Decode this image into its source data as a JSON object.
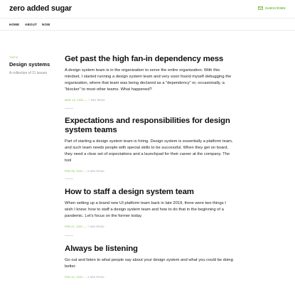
{
  "header": {
    "logo": "zero added sugar",
    "subscribe_label": "SUBSCRIBE"
  },
  "nav": {
    "items": [
      {
        "label": "HOME"
      },
      {
        "label": "ABOUT"
      },
      {
        "label": "NOW"
      }
    ]
  },
  "sidebar": {
    "kicker": "TOPIC",
    "title": "Design systems",
    "description": "A collection of 11 issues"
  },
  "posts": [
    {
      "title": "Get past the high fan-in dependency mess",
      "excerpt": "A design system team is in the organization to serve the entire organization. With this mindset, I started running a design system team and very soon found myself debugging the organization, where that team was being declared as a “dependency” or, occasionally, a “blocker” to most other teams. What happened?",
      "date": "MAR 14, 2022",
      "read": "— 7 MIN READ"
    },
    {
      "title": "Expectations and responsibilities for design system teams",
      "excerpt": "Part of starting a design system team is hiring. Design system is essentially a platform team, and such team needs people with special skills to be successful. When they get on board, they need a clear set of expectations and a launchpad for their career at the company. The tool",
      "date": "FEB 28, 2022",
      "read": "— 9 MIN READ"
    },
    {
      "title": "How to staff a design system team",
      "excerpt": "When setting up a brand new UI platform team back in late 2019, there were two things I wish I knew: how to staff a design system team and how to do that in the beginning of a pandemic. Let’s focus on the former today.",
      "date": "FEB 21, 2022",
      "read": "— 7 MIN READ"
    },
    {
      "title": "Always be listening",
      "excerpt": "Go out and listen to what people say about your design system and what you could be doing better.",
      "date": "FEB 14, 2022",
      "read": "— 3 MIN READ"
    }
  ],
  "colors": {
    "accent": "#6fbf3f",
    "text": "#111111",
    "muted": "#999999",
    "border": "#ececec"
  }
}
